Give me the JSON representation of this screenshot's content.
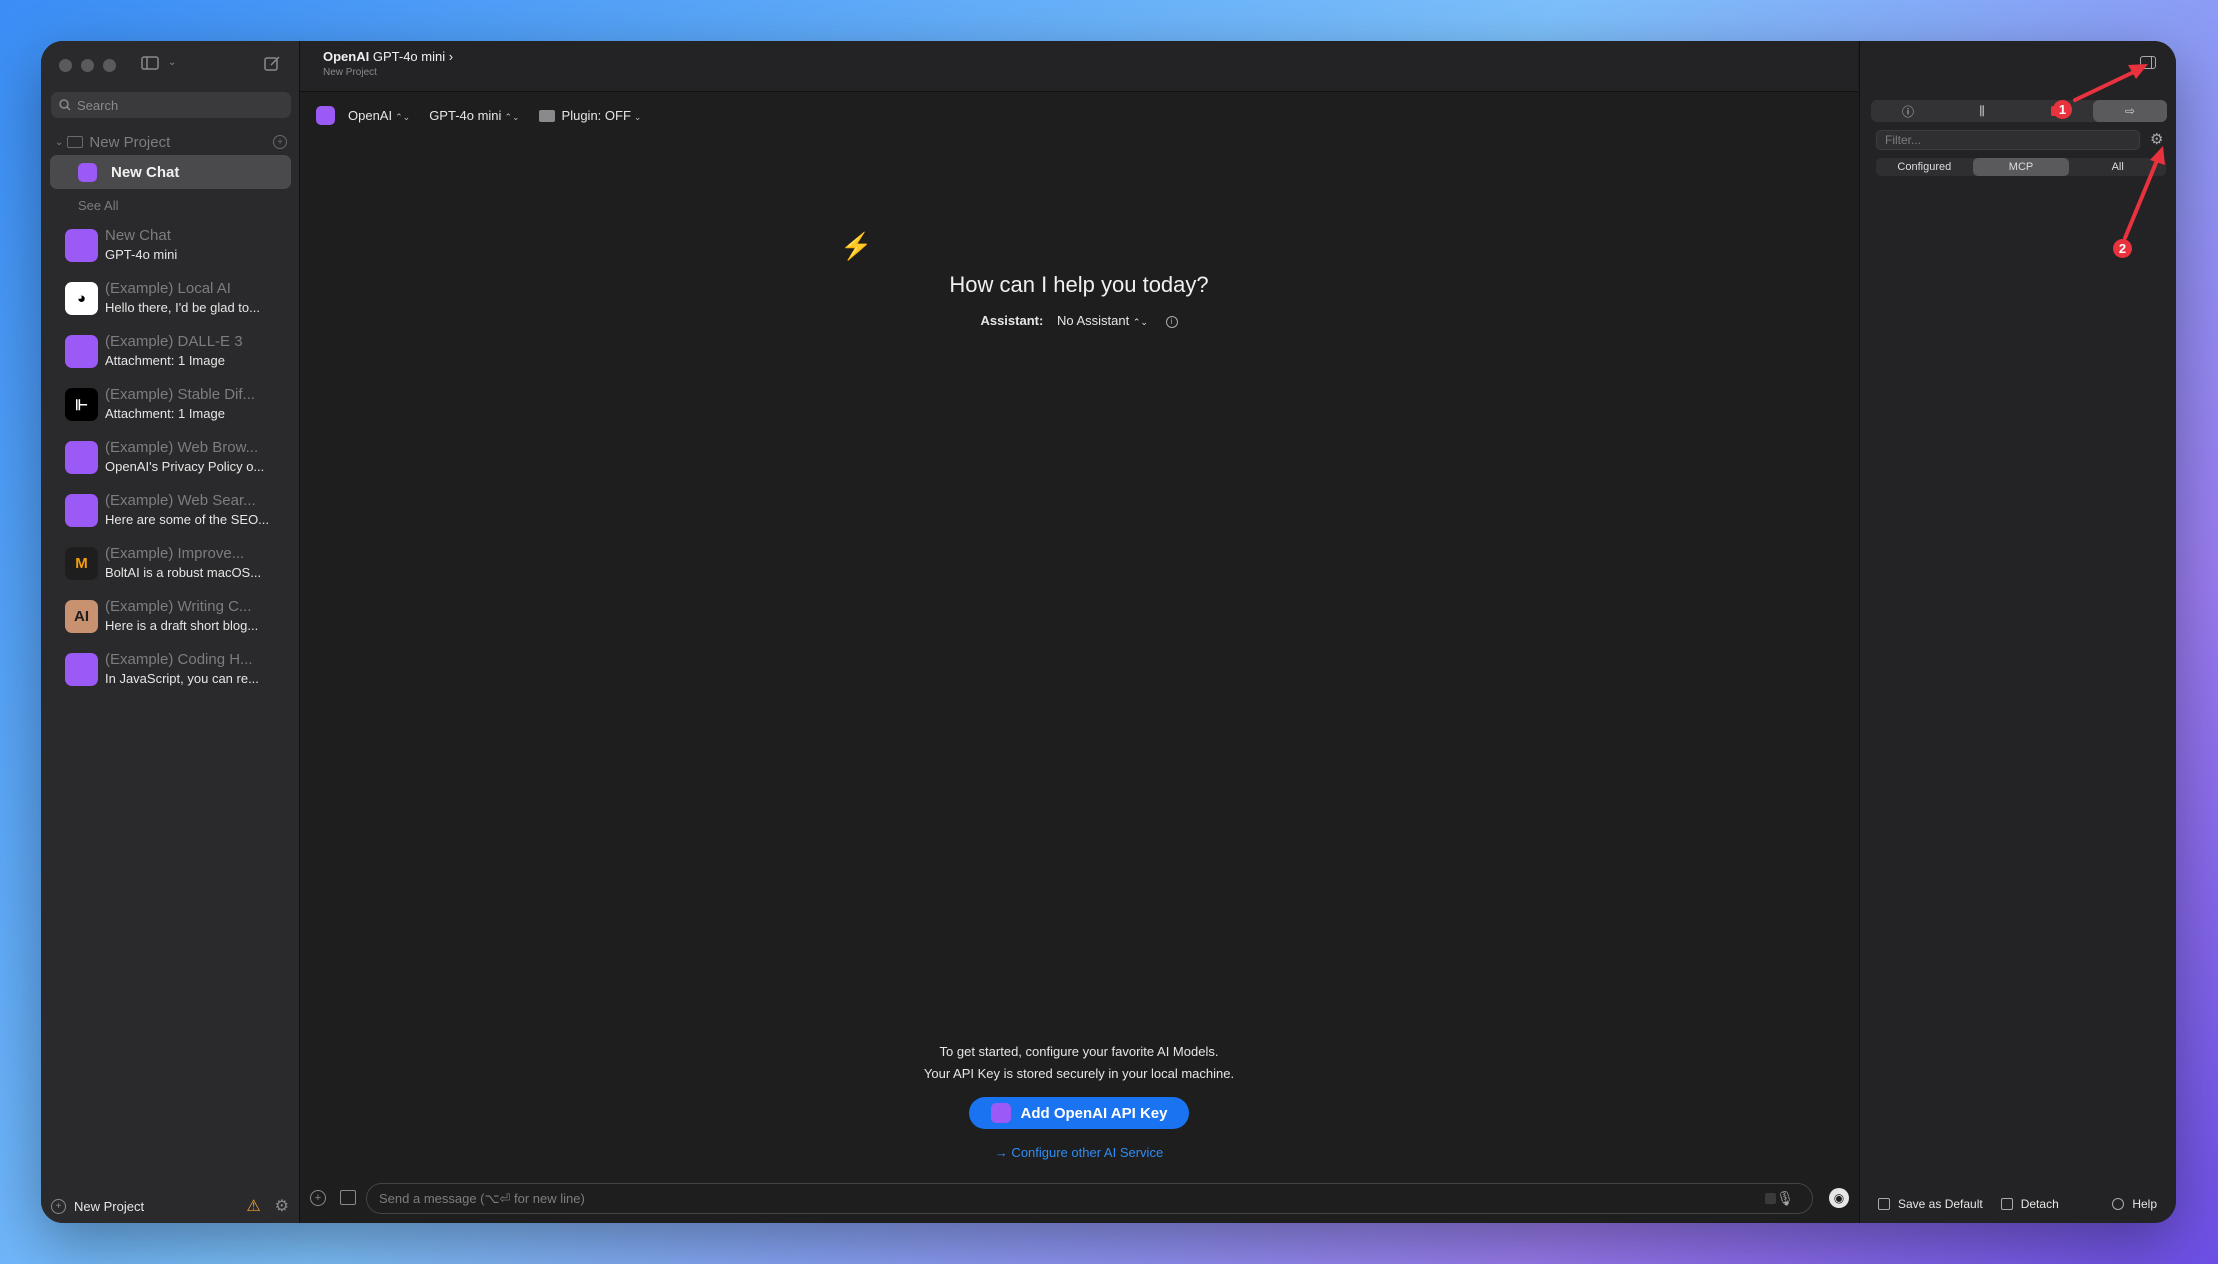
{
  "sidebar": {
    "search_placeholder": "Search",
    "project_name": "New Project",
    "active_chat": "New Chat",
    "see_all": "See All",
    "chats": [
      {
        "title": "New Chat",
        "subtitle": "GPT-4o mini",
        "icon": "openai-icon",
        "color": "#9b59f5",
        "glyph": ""
      },
      {
        "title": "(Example) Local AI",
        "subtitle": "Hello there, I'd be glad to...",
        "icon": "ollama-icon",
        "color": "#ffffff",
        "glyph": ""
      },
      {
        "title": "(Example) DALL-E 3",
        "subtitle": "Attachment: 1 Image",
        "icon": "openai-icon",
        "color": "#9b59f5",
        "glyph": ""
      },
      {
        "title": "(Example) Stable Dif...",
        "subtitle": "Attachment: 1 Image",
        "icon": "stability-icon",
        "color": "#000000",
        "glyph": "⊩"
      },
      {
        "title": "(Example) Web Brow...",
        "subtitle": "OpenAI's Privacy Policy o...",
        "icon": "openai-icon",
        "color": "#9b59f5",
        "glyph": ""
      },
      {
        "title": "(Example) Web Sear...",
        "subtitle": "Here are some of the SEO...",
        "icon": "openai-icon",
        "color": "#9b59f5",
        "glyph": ""
      },
      {
        "title": "(Example) Improve...",
        "subtitle": "BoltAI is a robust macOS...",
        "icon": "mistral-icon",
        "color": "#1e1e1f",
        "glyph": "M"
      },
      {
        "title": "(Example) Writing C...",
        "subtitle": "Here is a draft short blog...",
        "icon": "anthropic-icon",
        "color": "#c89170",
        "glyph": "AI"
      },
      {
        "title": "(Example) Coding H...",
        "subtitle": "In JavaScript, you can re...",
        "icon": "openai-icon",
        "color": "#9b59f5",
        "glyph": ""
      }
    ],
    "footer_project": "New Project"
  },
  "main": {
    "title_provider": "OpenAI",
    "title_model": "GPT-4o mini",
    "title_chevron": "›",
    "subtitle": "New Project",
    "toolbar": {
      "provider": "OpenAI",
      "model": "GPT-4o mini",
      "plugin": "Plugin: OFF",
      "updown": "⌃⌄"
    },
    "greeting": "How can I help you today?",
    "assistant_label": "Assistant:",
    "assistant_value": "No Assistant",
    "intro_line1": "To get started, configure your favorite AI Models.",
    "intro_line2": "Your API Key is stored securely in your local machine.",
    "add_key_button": "Add OpenAI API Key",
    "configure_link": "→ Configure other AI Service",
    "composer_placeholder": "Send a message (⌥⏎ for new line)"
  },
  "panel": {
    "filter_placeholder": "Filter...",
    "segments": [
      "Configured",
      "MCP",
      "All"
    ],
    "active_segment": "MCP",
    "footer": {
      "save_default": "Save as Default",
      "detach": "Detach",
      "help": "Help"
    }
  },
  "annotations": {
    "badge1": "1",
    "badge2": "2",
    "color": "#e8323d"
  }
}
